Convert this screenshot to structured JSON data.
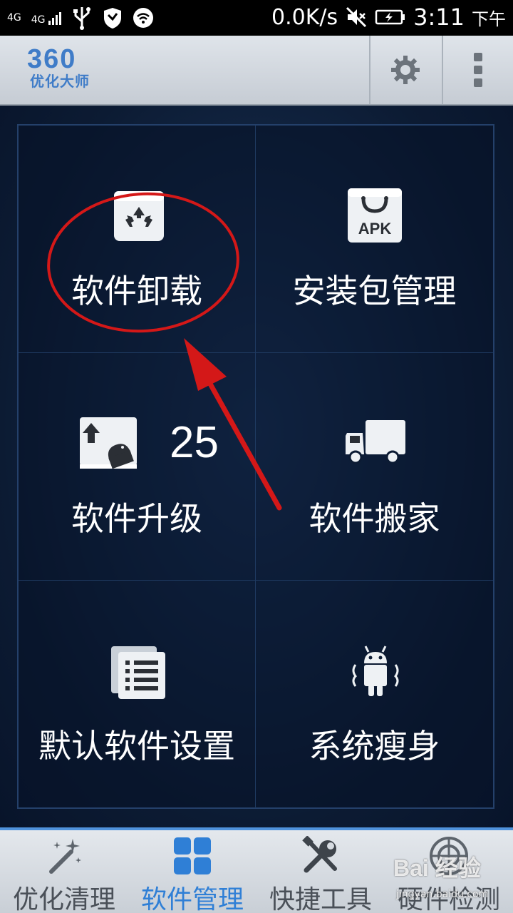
{
  "status_bar": {
    "network_left": "4G",
    "network_right": "4G",
    "net_speed": "0.0K/s",
    "time": "3:11",
    "ampm": "下午",
    "icons": [
      "usb-icon",
      "shield-icon",
      "wifi-icon",
      "mute-icon",
      "battery-icon"
    ]
  },
  "header": {
    "logo_number": "360",
    "logo_text": "优化大师",
    "icons": [
      "settings-icon",
      "more-menu-icon"
    ]
  },
  "tiles": [
    {
      "label": "软件卸载",
      "icon": "recycle-bin-icon"
    },
    {
      "label": "安装包管理",
      "icon": "apk-package-icon"
    },
    {
      "label": "软件升级",
      "icon": "android-upgrade-icon",
      "badge": "25"
    },
    {
      "label": "软件搬家",
      "icon": "moving-truck-icon"
    },
    {
      "label": "默认软件设置",
      "icon": "default-list-icon"
    },
    {
      "label": "系统瘦身",
      "icon": "android-slim-icon"
    }
  ],
  "bottom_nav": [
    {
      "label": "优化清理",
      "icon": "magic-wand-icon",
      "active": false
    },
    {
      "label": "软件管理",
      "icon": "grid-apps-icon",
      "active": true
    },
    {
      "label": "快捷工具",
      "icon": "tools-icon",
      "active": false
    },
    {
      "label": "硬件检测",
      "icon": "radar-icon",
      "active": false
    }
  ],
  "colors": {
    "accent": "#2f7fd6",
    "content_bg": "#0c1b33",
    "annotation": "#d41818"
  },
  "watermark": {
    "main": "Bai 经验",
    "sub": "jingyan.baidu.com"
  }
}
